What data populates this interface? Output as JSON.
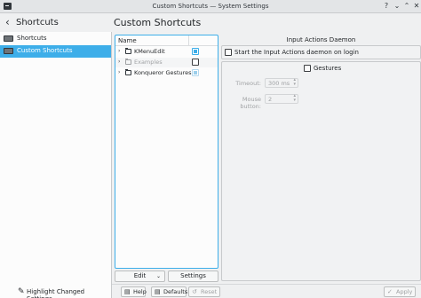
{
  "window": {
    "title": "Custom Shortcuts — System Settings",
    "controls": [
      "help-icon",
      "minimize-icon",
      "maximize-icon",
      "close-icon"
    ]
  },
  "sidebar": {
    "back_icon": "back-arrow-icon",
    "title": "Shortcuts",
    "items": [
      {
        "label": "Shortcuts",
        "icon": "keyboard-icon",
        "active": false
      },
      {
        "label": "Custom Shortcuts",
        "icon": "keyboard-icon",
        "active": true
      }
    ],
    "footer": {
      "icon": "highlight-icon",
      "label": "Highlight Changed Settings"
    }
  },
  "page": {
    "title": "Custom Shortcuts"
  },
  "tree": {
    "column_header": "Name",
    "rows": [
      {
        "label": "KMenuEdit",
        "checked": true,
        "disabled": false
      },
      {
        "label": "Examples",
        "checked": false,
        "disabled": true
      },
      {
        "label": "Konqueror Gestures",
        "checked": true,
        "disabled": false
      }
    ],
    "edit_button": "Edit",
    "settings_button": "Settings"
  },
  "daemon": {
    "group_title": "Input Actions Daemon",
    "start_on_login_label": "Start the Input Actions daemon on login",
    "start_on_login_checked": false
  },
  "gestures": {
    "label": "Gestures",
    "checked": false,
    "timeout_label": "Timeout:",
    "timeout_value": "300 ms",
    "mouse_button_label": "Mouse button:",
    "mouse_button_value": "2"
  },
  "footer": {
    "help": "Help",
    "defaults": "Defaults",
    "reset": "Reset",
    "apply": "Apply"
  },
  "colors": {
    "accent": "#3daee9",
    "background": "#eff0f1",
    "view": "#fcfcfc"
  }
}
